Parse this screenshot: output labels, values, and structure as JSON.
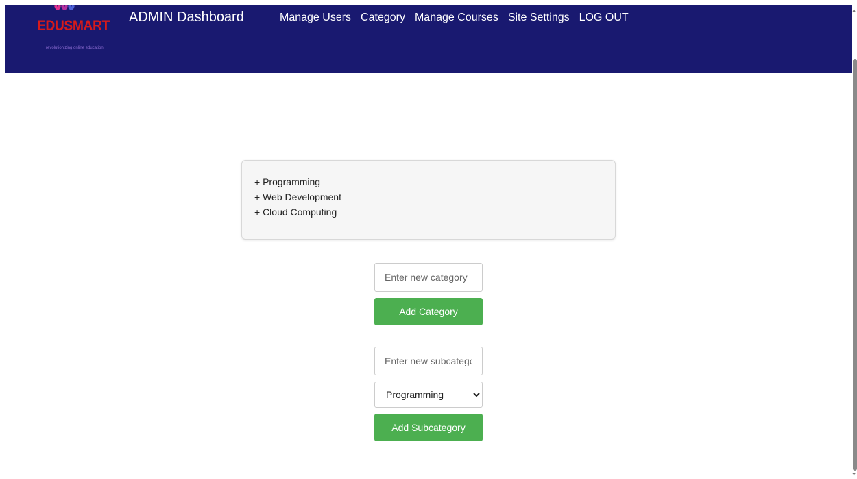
{
  "header": {
    "logo": {
      "text": "EDUSMART",
      "tagline": "revolutionizing online education"
    },
    "title": "ADMIN Dashboard",
    "nav": [
      {
        "label": "Manage Users"
      },
      {
        "label": "Category"
      },
      {
        "label": "Manage Courses"
      },
      {
        "label": "Site Settings"
      },
      {
        "label": "LOG OUT"
      }
    ]
  },
  "categories": [
    {
      "label": "+ Programming"
    },
    {
      "label": "+ Web Development"
    },
    {
      "label": "+ Cloud Computing"
    }
  ],
  "form": {
    "category_placeholder": "Enter new category",
    "add_category_label": "Add Category",
    "subcategory_placeholder": "Enter new subcategory",
    "parent_select": {
      "selected": "Programming"
    },
    "add_subcategory_label": "Add Subcategory"
  },
  "colors": {
    "header_bg": "#191970",
    "button_bg": "#4caf50",
    "logo_red": "#d71a1a"
  }
}
